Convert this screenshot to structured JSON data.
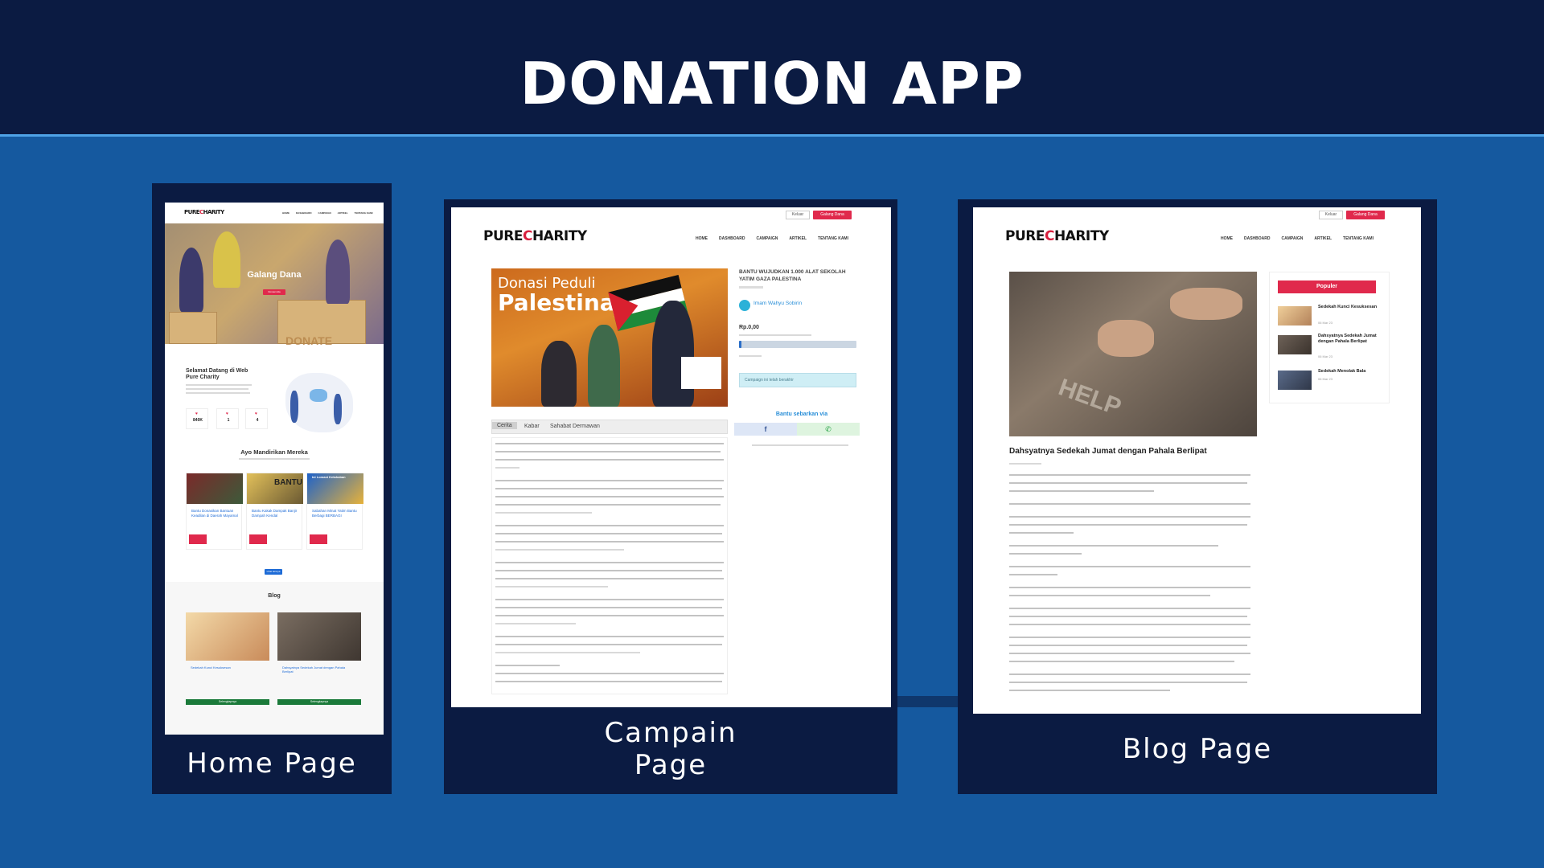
{
  "title": "DONATION APP",
  "panels": {
    "home": {
      "label": "Home Page"
    },
    "campaign": {
      "label_line1": "Campain",
      "label_line2": "Page"
    },
    "blog": {
      "label": "Blog Page"
    }
  },
  "site": {
    "logo_part1": "PURE",
    "logo_part2": "HARITY",
    "nav": [
      "HOME",
      "DASHBOARD",
      "CAMPAIGN",
      "ARTIKEL",
      "TENTANG KAMI"
    ],
    "login_label": "Keluar",
    "cta_label": "Galang Dana"
  },
  "home": {
    "hero_title": "Galang Dana",
    "hero_button": "Donasi Ada",
    "hero_watermark": "DONATE",
    "welcome_title": "Selamat Datang di Web Pure Charity",
    "stats": [
      "840K",
      "1",
      "4"
    ],
    "section_title": "Ayo Mandirikan Mereka",
    "cards": [
      {
        "title": "Bantu Donasikan Bantuan Keadilan di Daerah Mayamal"
      },
      {
        "title": "Bantu Kakak Dampak Banjir Dampah Kendal"
      },
      {
        "title": "Sabahan Minat Yatim Bantu Berbagi BERBAGI"
      }
    ],
    "card_banner_2": "BANTU",
    "card_banner_3": "Ini Lomani Ketahaban",
    "more_button": "Lihat lainnya",
    "blog_title": "Blog",
    "blog_posts": [
      {
        "title": "Sedekah Kunci Kesuksesan",
        "button": "Selengkapnya"
      },
      {
        "title": "Dahsyatnya Sedekah Jumat dengan Pahala Berlipat",
        "button": "Selengkapnya"
      }
    ]
  },
  "campaign": {
    "image_title1": "Donasi Peduli",
    "image_title2": "Palestina",
    "title": "BANTU WUJUDKAN 1.000 ALAT SEKOLAH YATIM GAZA PALESTINA",
    "author": "Imam Wahyu Sobirin",
    "amount": "Rp.0,00",
    "progress": 0.02,
    "info_box": "Campaign ini telah berakhir",
    "share_title": "Bantu sebarkan via",
    "tabs": [
      "Cerita",
      "Kabar",
      "Sahabat Dermawan"
    ]
  },
  "blog": {
    "image_word": "HELP",
    "title": "Dahsyatnya Sedekah Jumat dengan Pahala Berlipat",
    "popular_title": "Populer",
    "popular": [
      {
        "title": "Sedekah Kunci Kesuksesan",
        "date": "06 Mar 23"
      },
      {
        "title": "Dahsyatnya Sedekah Jumat dengan Pahala Berlipat",
        "date": "06 Mar 23"
      },
      {
        "title": "Sedekah Menolak Bala",
        "date": "06 Mar 23"
      }
    ]
  },
  "colors": {
    "background": "#15599f",
    "band": "#0b1b42",
    "accent_red": "#e0294c"
  }
}
